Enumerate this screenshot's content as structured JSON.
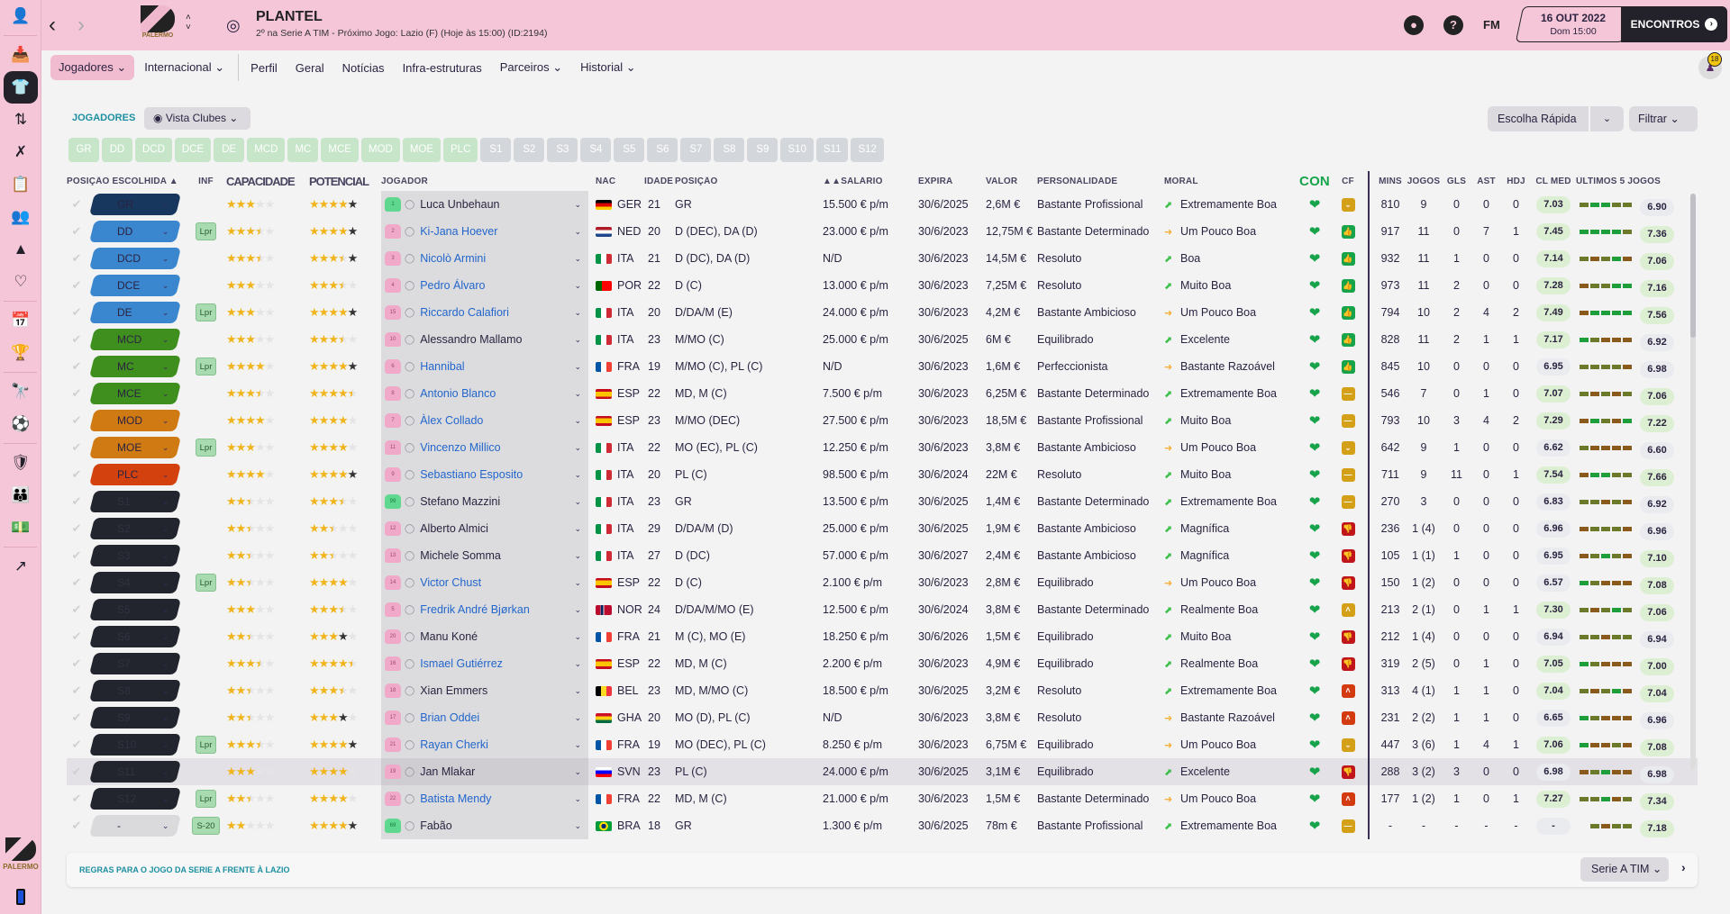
{
  "header": {
    "title": "PLANTEL",
    "subtitle": "2º na Serie A TIM - Próximo Jogo: Lazio (F) (Hoje às 15:00) (ID:2194)",
    "club_name": "PALERMO",
    "fm_label": "FM",
    "date_main": "16 OUT 2022",
    "date_sub": "Dom 15:00",
    "continue_label": "ENCONTROS",
    "notification_count": "18"
  },
  "subnav": [
    {
      "label": "Jogadores ⌄",
      "active": true
    },
    {
      "label": "Internacional ⌄"
    },
    {
      "label": "Perfil"
    },
    {
      "label": "Geral"
    },
    {
      "label": "Notícias"
    },
    {
      "label": "Infra-estruturas"
    },
    {
      "label": "Parceiros ⌄"
    },
    {
      "label": "Historial ⌄"
    }
  ],
  "toolbar": {
    "section_label": "JOGADORES",
    "view_label": "Vista Clubes",
    "quick_pick_label": "Escolha Rápida",
    "filter_label": "Filtrar"
  },
  "position_chips": {
    "starting": [
      "GR",
      "DD",
      "DCD",
      "DCE",
      "DE",
      "MCD",
      "MC",
      "MCE",
      "MOD",
      "MOE",
      "PLC"
    ],
    "subs": [
      "S1",
      "S2",
      "S3",
      "S4",
      "S5",
      "S6",
      "S7",
      "S8",
      "S9",
      "S10",
      "S11",
      "S12"
    ]
  },
  "columns": {
    "pos": "POSIÇÃO ESCOLHIDA ▲",
    "inf": "INF",
    "cap": "CAPACIDADE",
    "pot": "POTENCIAL",
    "jog": "JOGADOR",
    "nac": "NAC",
    "age": "IDADE",
    "posi": "POSIÇÃO",
    "sal": "▲▲SALÁRIO",
    "exp": "EXPIRA",
    "val": "VALOR",
    "per": "PERSONALIDADE",
    "mor": "MORAL",
    "con": "CON",
    "cf": "CF",
    "mins": "MINS",
    "jogos": "JOGOS",
    "gls": "GLS",
    "ast": "AST",
    "hdj": "HDJ",
    "clm": "CL MED",
    "u5": "ÚLTIMOS 5 JOGOS"
  },
  "colors": {
    "accent_pink": "#f5c6d8",
    "teal_label": "#1c8fa0",
    "link_blue": "#2266cc",
    "gk": "#17375e",
    "def": "#3a86cf",
    "mid": "#3f8f1f",
    "amid": "#cf7a12",
    "fwd": "#d3410f",
    "sub": "#23252e",
    "none": "#dadadd"
  },
  "players": [
    {
      "slot": "GR",
      "grp": "gk",
      "inf": "",
      "cap": 3,
      "pot": 4,
      "potd": 1,
      "shirt": "1",
      "gk": true,
      "name": "Luca Unbehaun",
      "link": false,
      "nac": "GER",
      "age": "21",
      "posi": "GR",
      "sal": "15.500 € p/m",
      "exp": "30/6/2025",
      "val": "2,6M €",
      "per": "Bastante Profissional",
      "mor": "Extremamente Boa",
      "mdir": "up",
      "cf": "down",
      "mins": "810",
      "jogos": "9",
      "gls": "0",
      "ast": "0",
      "hdj": "0",
      "clm": "7.03",
      "clg": true,
      "u5": [
        "o",
        "g",
        "g",
        "o",
        "o"
      ],
      "avg": "6.90",
      "avgg": false
    },
    {
      "slot": "DD",
      "grp": "def",
      "inf": "Lpr",
      "cap": 3.5,
      "pot": 4,
      "potd": 1,
      "shirt": "2",
      "name": "Ki-Jana Hoever",
      "link": true,
      "nac": "NED",
      "age": "20",
      "posi": "D (DEC), DA (D)",
      "sal": "23.000 € p/m",
      "exp": "30/6/2023",
      "val": "12,75M €",
      "per": "Bastante Determinado",
      "mor": "Um Pouco Boa",
      "mdir": "side",
      "cf": "up",
      "mins": "917",
      "jogos": "11",
      "gls": "0",
      "ast": "7",
      "hdj": "1",
      "clm": "7.45",
      "clg": true,
      "u5": [
        "g",
        "g",
        "g",
        "g",
        "o"
      ],
      "avg": "7.36",
      "avgg": true
    },
    {
      "slot": "DCD",
      "grp": "def",
      "inf": "",
      "cap": 3.5,
      "pot": 3.5,
      "potd": 1,
      "shirt": "3",
      "name": "Nicolò Armini",
      "link": true,
      "nac": "ITA",
      "age": "21",
      "posi": "D (DC), DA (D)",
      "sal": "N/D",
      "exp": "30/6/2023",
      "val": "14,5M €",
      "per": "Resoluto",
      "mor": "Boa",
      "mdir": "up",
      "cf": "up",
      "mins": "932",
      "jogos": "11",
      "gls": "1",
      "ast": "0",
      "hdj": "0",
      "clm": "7.14",
      "clg": true,
      "u5": [
        "o",
        "b",
        "o",
        "g",
        "b"
      ],
      "avg": "7.06",
      "avgg": true
    },
    {
      "slot": "DCE",
      "grp": "def",
      "inf": "",
      "cap": 3,
      "pot": 3.5,
      "potd": 0,
      "shirt": "4",
      "name": "Pedro Álvaro",
      "link": true,
      "nac": "POR",
      "age": "22",
      "posi": "D (C)",
      "sal": "13.000 € p/m",
      "exp": "30/6/2023",
      "val": "7,25M €",
      "per": "Resoluto",
      "mor": "Muito Boa",
      "mdir": "up",
      "cf": "up",
      "mins": "973",
      "jogos": "11",
      "gls": "2",
      "ast": "0",
      "hdj": "0",
      "clm": "7.28",
      "clg": true,
      "u5": [
        "b",
        "o",
        "o",
        "g",
        "g"
      ],
      "avg": "7.16",
      "avgg": true
    },
    {
      "slot": "DE",
      "grp": "def",
      "inf": "Lpr",
      "cap": 3,
      "pot": 4,
      "potd": 1,
      "shirt": "15",
      "name": "Riccardo Calafiori",
      "link": true,
      "nac": "ITA",
      "age": "20",
      "posi": "D/DA/M (E)",
      "sal": "24.000 € p/m",
      "exp": "30/6/2023",
      "val": "4,2M €",
      "per": "Bastante Ambicioso",
      "mor": "Um Pouco Boa",
      "mdir": "side",
      "cf": "up",
      "mins": "794",
      "jogos": "10",
      "gls": "2",
      "ast": "4",
      "hdj": "2",
      "clm": "7.49",
      "clg": true,
      "u5": [
        "b",
        "g",
        "g",
        "g",
        "g"
      ],
      "avg": "7.56",
      "avgg": true
    },
    {
      "slot": "MCD",
      "grp": "mid",
      "inf": "",
      "cap": 3,
      "pot": 3.5,
      "potd": 0,
      "shirt": "10",
      "name": "Alessandro Mallamo",
      "link": false,
      "nac": "ITA",
      "age": "23",
      "posi": "M/MO (C)",
      "sal": "25.000 € p/m",
      "exp": "30/6/2025",
      "val": "6M €",
      "per": "Equilibrado",
      "mor": "Excelente",
      "mdir": "up",
      "cf": "up",
      "mins": "828",
      "jogos": "11",
      "gls": "2",
      "ast": "1",
      "hdj": "1",
      "clm": "7.17",
      "clg": true,
      "u5": [
        "g",
        "o",
        "b",
        "b",
        "b"
      ],
      "avg": "6.92",
      "avgg": false
    },
    {
      "slot": "MC",
      "grp": "mid",
      "inf": "Lpr",
      "cap": 4,
      "pot": 4,
      "potd": 1,
      "shirt": "6",
      "name": "Hannibal",
      "link": true,
      "nac": "FRA",
      "age": "19",
      "posi": "M/MO (C), PL (C)",
      "sal": "N/D",
      "exp": "30/6/2023",
      "val": "1,6M €",
      "per": "Perfeccionista",
      "mor": "Bastante Razoável",
      "mdir": "side",
      "cf": "up",
      "mins": "845",
      "jogos": "10",
      "gls": "0",
      "ast": "0",
      "hdj": "0",
      "clm": "6.95",
      "clg": false,
      "u5": [
        "o",
        "o",
        "o",
        "o",
        "b"
      ],
      "avg": "6.98",
      "avgg": false
    },
    {
      "slot": "MCE",
      "grp": "mid",
      "inf": "",
      "cap": 3.5,
      "pot": 4.5,
      "potd": 0,
      "shirt": "8",
      "name": "Antonio Blanco",
      "link": true,
      "nac": "ESP",
      "age": "22",
      "posi": "MD, M (C)",
      "sal": "7.500 € p/m",
      "exp": "30/6/2023",
      "val": "6,25M €",
      "per": "Bastante Determinado",
      "mor": "Extremamente Boa",
      "mdir": "up",
      "cf": "neutral",
      "mins": "546",
      "jogos": "7",
      "gls": "0",
      "ast": "1",
      "hdj": "0",
      "clm": "7.07",
      "clg": true,
      "u5": [
        "o",
        "b",
        "o",
        "b",
        "o"
      ],
      "avg": "7.06",
      "avgg": true
    },
    {
      "slot": "MOD",
      "grp": "amid",
      "inf": "",
      "cap": 4,
      "pot": 4,
      "potd": 0,
      "shirt": "7",
      "name": "Àlex Collado",
      "link": true,
      "nac": "ESP",
      "age": "23",
      "posi": "M/MO (DEC)",
      "sal": "27.500 € p/m",
      "exp": "30/6/2023",
      "val": "18,5M €",
      "per": "Bastante Profissional",
      "mor": "Muito Boa",
      "mdir": "up",
      "cf": "neutral",
      "mins": "793",
      "jogos": "10",
      "gls": "3",
      "ast": "4",
      "hdj": "2",
      "clm": "7.29",
      "clg": true,
      "u5": [
        "b",
        "g",
        "o",
        "b",
        "g"
      ],
      "avg": "7.22",
      "avgg": true
    },
    {
      "slot": "MOE",
      "grp": "amid",
      "inf": "Lpr",
      "cap": 3,
      "pot": 4,
      "potd": 0,
      "shirt": "11",
      "name": "Vincenzo Millico",
      "link": true,
      "nac": "ITA",
      "age": "22",
      "posi": "MO (EC), PL (C)",
      "sal": "12.250 € p/m",
      "exp": "30/6/2023",
      "val": "3,8M €",
      "per": "Bastante Ambicioso",
      "mor": "Um Pouco Boa",
      "mdir": "side",
      "cf": "down",
      "mins": "642",
      "jogos": "9",
      "gls": "1",
      "ast": "0",
      "hdj": "0",
      "clm": "6.62",
      "clg": false,
      "u5": [
        "o",
        "b",
        "b",
        "b",
        "b"
      ],
      "avg": "6.60",
      "avgg": false
    },
    {
      "slot": "PLC",
      "grp": "fwd",
      "inf": "",
      "cap": 4,
      "pot": 4,
      "potd": 1,
      "shirt": "9",
      "name": "Sebastiano Esposito",
      "link": true,
      "nac": "ITA",
      "age": "20",
      "posi": "PL (C)",
      "sal": "98.500 € p/m",
      "exp": "30/6/2024",
      "val": "22M €",
      "per": "Resoluto",
      "mor": "Muito Boa",
      "mdir": "up",
      "cf": "neutral",
      "mins": "711",
      "jogos": "9",
      "gls": "11",
      "ast": "0",
      "hdj": "1",
      "clm": "7.54",
      "clg": true,
      "u5": [
        "b",
        "g",
        "g",
        "o",
        "o"
      ],
      "avg": "7.66",
      "avgg": true
    },
    {
      "slot": "S1",
      "grp": "sub",
      "inf": "",
      "cap": 2.5,
      "pot": 3.5,
      "potd": 0,
      "shirt": "99",
      "gk": true,
      "name": "Stefano Mazzini",
      "link": false,
      "nac": "ITA",
      "age": "23",
      "posi": "GR",
      "sal": "13.500 € p/m",
      "exp": "30/6/2025",
      "val": "1,4M €",
      "per": "Bastante Determinado",
      "mor": "Extremamente Boa",
      "mdir": "up",
      "cf": "neutral",
      "mins": "270",
      "jogos": "3",
      "gls": "0",
      "ast": "0",
      "hdj": "0",
      "clm": "6.83",
      "clg": false,
      "u5": [
        "o",
        "o",
        "b",
        "o",
        "b"
      ],
      "avg": "6.92",
      "avgg": false
    },
    {
      "slot": "S2",
      "grp": "sub",
      "inf": "",
      "cap": 2.5,
      "pot": 2.5,
      "potd": 0,
      "shirt": "12",
      "name": "Alberto Almici",
      "link": false,
      "nac": "ITA",
      "age": "29",
      "posi": "D/DA/M (D)",
      "sal": "25.000 € p/m",
      "exp": "30/6/2025",
      "val": "1,9M €",
      "per": "Bastante Ambicioso",
      "mor": "Magnífica",
      "mdir": "up",
      "cf": "thumbdown",
      "mins": "236",
      "jogos": "1 (4)",
      "gls": "0",
      "ast": "0",
      "hdj": "0",
      "clm": "6.96",
      "clg": false,
      "u5": [
        "b",
        "o",
        "o",
        "o",
        "b"
      ],
      "avg": "6.96",
      "avgg": false
    },
    {
      "slot": "S3",
      "grp": "sub",
      "inf": "",
      "cap": 2.5,
      "pot": 2.5,
      "potd": 0,
      "shirt": "13",
      "name": "Michele Somma",
      "link": false,
      "nac": "ITA",
      "age": "27",
      "posi": "D (DC)",
      "sal": "57.000 € p/m",
      "exp": "30/6/2027",
      "val": "2,4M €",
      "per": "Bastante Ambicioso",
      "mor": "Magnífica",
      "mdir": "up",
      "cf": "thumbdown",
      "mins": "105",
      "jogos": "1 (1)",
      "gls": "1",
      "ast": "0",
      "hdj": "0",
      "clm": "6.95",
      "clg": false,
      "u5": [
        "b",
        "o",
        "g",
        "o",
        "b"
      ],
      "avg": "7.10",
      "avgg": true
    },
    {
      "slot": "S4",
      "grp": "sub",
      "inf": "Lpr",
      "cap": 2.5,
      "pot": 4,
      "potd": 0,
      "shirt": "14",
      "name": "Victor Chust",
      "link": true,
      "nac": "ESP",
      "age": "22",
      "posi": "D (C)",
      "sal": "2.100 € p/m",
      "exp": "30/6/2023",
      "val": "2,8M €",
      "per": "Equilibrado",
      "mor": "Um Pouco Boa",
      "mdir": "side",
      "cf": "thumbdown",
      "mins": "150",
      "jogos": "1 (2)",
      "gls": "0",
      "ast": "0",
      "hdj": "0",
      "clm": "6.57",
      "clg": false,
      "u5": [
        "g",
        "o",
        "b",
        "b",
        "b"
      ],
      "avg": "7.08",
      "avgg": true
    },
    {
      "slot": "S5",
      "grp": "sub",
      "inf": "",
      "cap": 3,
      "pot": 3.5,
      "potd": 0,
      "shirt": "5",
      "name": "Fredrik André Bjørkan",
      "link": true,
      "nac": "NOR",
      "age": "24",
      "posi": "D/DA/M/MO (E)",
      "sal": "12.500 € p/m",
      "exp": "30/6/2024",
      "val": "3,8M €",
      "per": "Bastante Determinado",
      "mor": "Realmente Boa",
      "mdir": "up",
      "cf": "upchev",
      "mins": "213",
      "jogos": "2 (1)",
      "gls": "0",
      "ast": "1",
      "hdj": "1",
      "clm": "7.30",
      "clg": true,
      "u5": [
        "o",
        "b",
        "o",
        "g",
        "o"
      ],
      "avg": "7.06",
      "avgg": true
    },
    {
      "slot": "S6",
      "grp": "sub",
      "inf": "",
      "cap": 2.5,
      "pot": 3,
      "potd": 1,
      "shirt": "20",
      "name": "Manu Koné",
      "link": false,
      "nac": "FRA",
      "age": "21",
      "posi": "M (C), MO (E)",
      "sal": "18.250 € p/m",
      "exp": "30/6/2026",
      "val": "1,5M €",
      "per": "Equilibrado",
      "mor": "Muito Boa",
      "mdir": "up",
      "cf": "thumbdown",
      "mins": "212",
      "jogos": "1 (4)",
      "gls": "0",
      "ast": "0",
      "hdj": "0",
      "clm": "6.94",
      "clg": false,
      "u5": [
        "o",
        "o",
        "b",
        "o",
        "o"
      ],
      "avg": "6.94",
      "avgg": false
    },
    {
      "slot": "S7",
      "grp": "sub",
      "inf": "",
      "cap": 3.5,
      "pot": 4.5,
      "potd": 0,
      "shirt": "16",
      "name": "Ismael Gutiérrez",
      "link": true,
      "nac": "ESP",
      "age": "22",
      "posi": "MD, M (C)",
      "sal": "2.200 € p/m",
      "exp": "30/6/2023",
      "val": "4,9M €",
      "per": "Equilibrado",
      "mor": "Realmente Boa",
      "mdir": "up",
      "cf": "thumbdown",
      "mins": "319",
      "jogos": "2 (5)",
      "gls": "0",
      "ast": "1",
      "hdj": "0",
      "clm": "7.05",
      "clg": true,
      "u5": [
        "g",
        "o",
        "b",
        "b",
        "b"
      ],
      "avg": "7.00",
      "avgg": true
    },
    {
      "slot": "S8",
      "grp": "sub",
      "inf": "",
      "cap": 2.5,
      "pot": 3.5,
      "potd": 0,
      "shirt": "18",
      "name": "Xian Emmers",
      "link": false,
      "nac": "BEL",
      "age": "23",
      "posi": "MD, M/MO (C)",
      "sal": "18.500 € p/m",
      "exp": "30/6/2025",
      "val": "3,2M €",
      "per": "Resoluto",
      "mor": "Extremamente Boa",
      "mdir": "up",
      "cf": "upchevred",
      "mins": "313",
      "jogos": "4 (1)",
      "gls": "1",
      "ast": "1",
      "hdj": "0",
      "clm": "7.04",
      "clg": true,
      "u5": [
        "o",
        "b",
        "o",
        "g",
        "b"
      ],
      "avg": "7.04",
      "avgg": true
    },
    {
      "slot": "S9",
      "grp": "sub",
      "inf": "",
      "cap": 2.5,
      "pot": 3,
      "potd": 1,
      "shirt": "17",
      "name": "Brian Oddei",
      "link": true,
      "nac": "GHA",
      "age": "20",
      "posi": "MO (D), PL (C)",
      "sal": "N/D",
      "exp": "30/6/2023",
      "val": "3,8M €",
      "per": "Resoluto",
      "mor": "Bastante Razoável",
      "mdir": "side",
      "cf": "upchevred",
      "mins": "231",
      "jogos": "2 (2)",
      "gls": "1",
      "ast": "1",
      "hdj": "0",
      "clm": "6.65",
      "clg": false,
      "u5": [
        "g",
        "o",
        "b",
        "b",
        "b"
      ],
      "avg": "6.96",
      "avgg": false
    },
    {
      "slot": "S10",
      "grp": "sub",
      "inf": "Lpr",
      "cap": 3.5,
      "pot": 4,
      "potd": 1,
      "shirt": "21",
      "name": "Rayan Cherki",
      "link": true,
      "nac": "FRA",
      "age": "19",
      "posi": "MO (DEC), PL (C)",
      "sal": "8.250 € p/m",
      "exp": "30/6/2023",
      "val": "6,75M €",
      "per": "Equilibrado",
      "mor": "Um Pouco Boa",
      "mdir": "side",
      "cf": "down",
      "mins": "447",
      "jogos": "3 (6)",
      "gls": "1",
      "ast": "4",
      "hdj": "1",
      "clm": "7.06",
      "clg": true,
      "u5": [
        "g",
        "b",
        "b",
        "o",
        "b"
      ],
      "avg": "7.08",
      "avgg": true
    },
    {
      "slot": "S11",
      "grp": "sub",
      "inf": "",
      "cap": 3,
      "pot": 4,
      "potd": 0,
      "shirt": "19",
      "name": "Jan Mlakar",
      "link": false,
      "nac": "SVN",
      "age": "23",
      "posi": "PL (C)",
      "sal": "24.000 € p/m",
      "exp": "30/6/2025",
      "val": "3,1M €",
      "per": "Equilibrado",
      "mor": "Excelente",
      "mdir": "up",
      "cf": "thumbdown",
      "mins": "288",
      "jogos": "3 (2)",
      "gls": "3",
      "ast": "0",
      "hdj": "0",
      "clm": "6.98",
      "clg": false,
      "u5": [
        "b",
        "o",
        "g",
        "b",
        "b"
      ],
      "avg": "6.98",
      "avgg": false,
      "hl": true
    },
    {
      "slot": "S12",
      "grp": "sub",
      "inf": "Lpr",
      "cap": 2.5,
      "pot": 4,
      "potd": 0,
      "shirt": "22",
      "name": "Batista Mendy",
      "link": true,
      "nac": "FRA",
      "age": "22",
      "posi": "MD, M (C)",
      "sal": "21.000 € p/m",
      "exp": "30/6/2023",
      "val": "1,5M €",
      "per": "Bastante Determinado",
      "mor": "Um Pouco Boa",
      "mdir": "side",
      "cf": "upchevred",
      "mins": "177",
      "jogos": "1 (2)",
      "gls": "1",
      "ast": "0",
      "hdj": "1",
      "clm": "7.27",
      "clg": true,
      "u5": [
        "o",
        "o",
        "g",
        "b",
        "o"
      ],
      "avg": "7.34",
      "avgg": true
    },
    {
      "slot": "-",
      "grp": "none",
      "inf": "S-20",
      "cap": 2,
      "pot": 4,
      "potd": 1,
      "shirt": "69",
      "gk": true,
      "name": "Fabão",
      "link": false,
      "nac": "BRA",
      "age": "18",
      "posi": "GR",
      "sal": "1.300 € p/m",
      "exp": "30/6/2025",
      "val": "78m €",
      "per": "Bastante Profissional",
      "mor": "Extremamente Boa",
      "mdir": "up",
      "cf": "neutral",
      "mins": "-",
      "jogos": "-",
      "gls": "-",
      "ast": "-",
      "hdj": "-",
      "clm": "-",
      "clg": false,
      "u5": [
        "",
        "o",
        "b",
        "o",
        "o"
      ],
      "avg": "7.18",
      "avgg": true
    }
  ],
  "footer": {
    "rules_text": "REGRAS PARA O JOGO DA SERIE A FRENTE À LAZIO",
    "league_label": "Serie A TIM"
  }
}
